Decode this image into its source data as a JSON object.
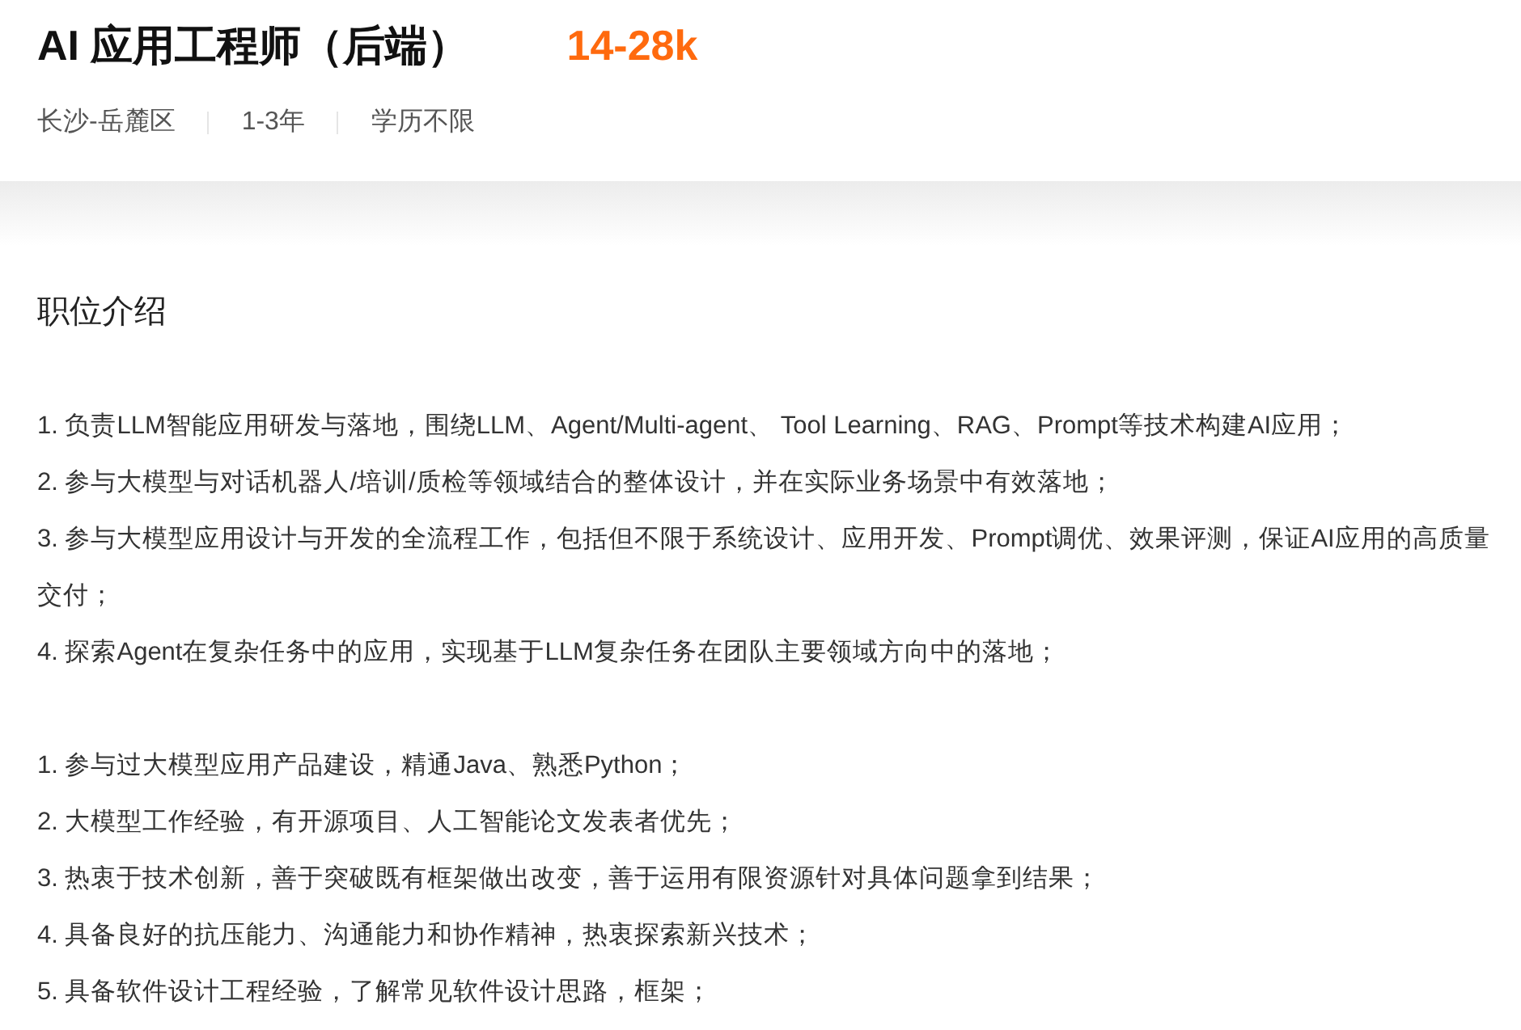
{
  "job": {
    "title": "AI 应用工程师（后端）",
    "salary": "14-28k",
    "tags": [
      "长沙-岳麓区",
      "1-3年",
      "学历不限"
    ]
  },
  "section": {
    "heading": "职位介绍",
    "duties": [
      "1. 负责LLM智能应用研发与落地，围绕LLM、Agent/Multi-agent、 Tool Learning、RAG、Prompt等技术构建AI应用；",
      "2. 参与大模型与对话机器人/培训/质检等领域结合的整体设计，并在实际业务场景中有效落地；",
      "3. 参与大模型应用设计与开发的全流程工作，包括但不限于系统设计、应用开发、Prompt调优、效果评测，保证AI应用的高质量交付；",
      "4. 探索Agent在复杂任务中的应用，实现基于LLM复杂任务在团队主要领域方向中的落地；"
    ],
    "requirements": [
      "1. 参与过大模型应用产品建设，精通Java、熟悉Python；",
      "2. 大模型工作经验，有开源项目、人工智能论文发表者优先；",
      "3. 热衷于技术创新，善于突破既有框架做出改变，善于运用有限资源针对具体问题拿到结果；",
      "4. 具备良好的抗压能力、沟通能力和协作精神，热衷探索新兴技术；",
      "5. 具备软件设计工程经验，了解常见软件设计思路，框架；"
    ]
  }
}
